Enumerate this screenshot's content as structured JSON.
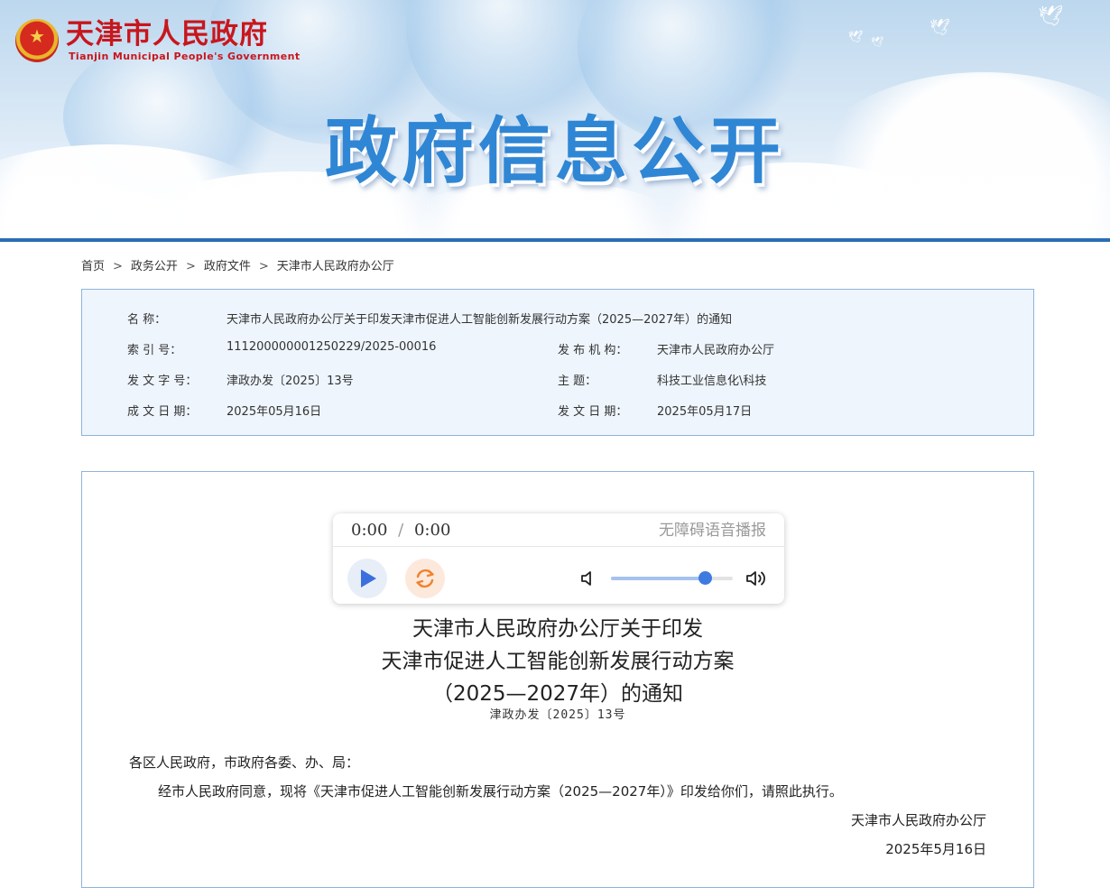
{
  "header": {
    "site_name_cn": "天津市人民政府",
    "site_name_en": "Tianjin Municipal People's Government",
    "banner_title": "政府信息公开"
  },
  "breadcrumb": {
    "items": [
      "首页",
      "政务公开",
      "政府文件",
      "天津市人民政府办公厅"
    ],
    "separator": ">"
  },
  "info": {
    "name_label": "名 称：",
    "name_value": "天津市人民政府办公厅关于印发天津市促进人工智能创新发展行动方案（2025—2027年）的通知",
    "index_label": "索 引 号：",
    "index_value": "111200000001250229/2025-00016",
    "publisher_label": "发 布 机 构：",
    "publisher_value": "天津市人民政府办公厅",
    "doc_no_label": "发 文 字 号：",
    "doc_no_value": "津政办发〔2025〕13号",
    "topic_label": "主 题：",
    "topic_value": "科技工业信息化\\科技",
    "created_label": "成 文 日 期：",
    "created_value": "2025年05月16日",
    "published_label": "发 文 日 期：",
    "published_value": "2025年05月17日"
  },
  "player": {
    "current_time": "0:00",
    "separator": "/",
    "duration": "0:00",
    "barrier_free_label": "无障碍语音播报",
    "volume": 0.77,
    "icons": {
      "play": "play-icon",
      "loop": "loop-icon",
      "volume_low": "volume-low-icon",
      "volume_high": "volume-high-icon"
    }
  },
  "document": {
    "title_line1": "天津市人民政府办公厅关于印发",
    "title_line2": "天津市促进人工智能创新发展行动方案",
    "title_line3": "（2025—2027年）的通知",
    "number": "津政办发〔2025〕13号",
    "salutation": "各区人民政府，市政府各委、办、局：",
    "body": "经市人民政府同意，现将《天津市促进人工智能创新发展行动方案（2025—2027年）》印发给你们，请照此执行。",
    "signature": "天津市人民政府办公厅",
    "date": "2025年5月16日"
  },
  "colors": {
    "accent_blue": "#2a6db4",
    "title_blue": "#2f86d4",
    "logo_red": "#c8161d",
    "info_bg": "#eef5fd",
    "border": "#8fb4da",
    "slider_knob": "#3d7be0",
    "loop_orange": "#f0822e"
  }
}
